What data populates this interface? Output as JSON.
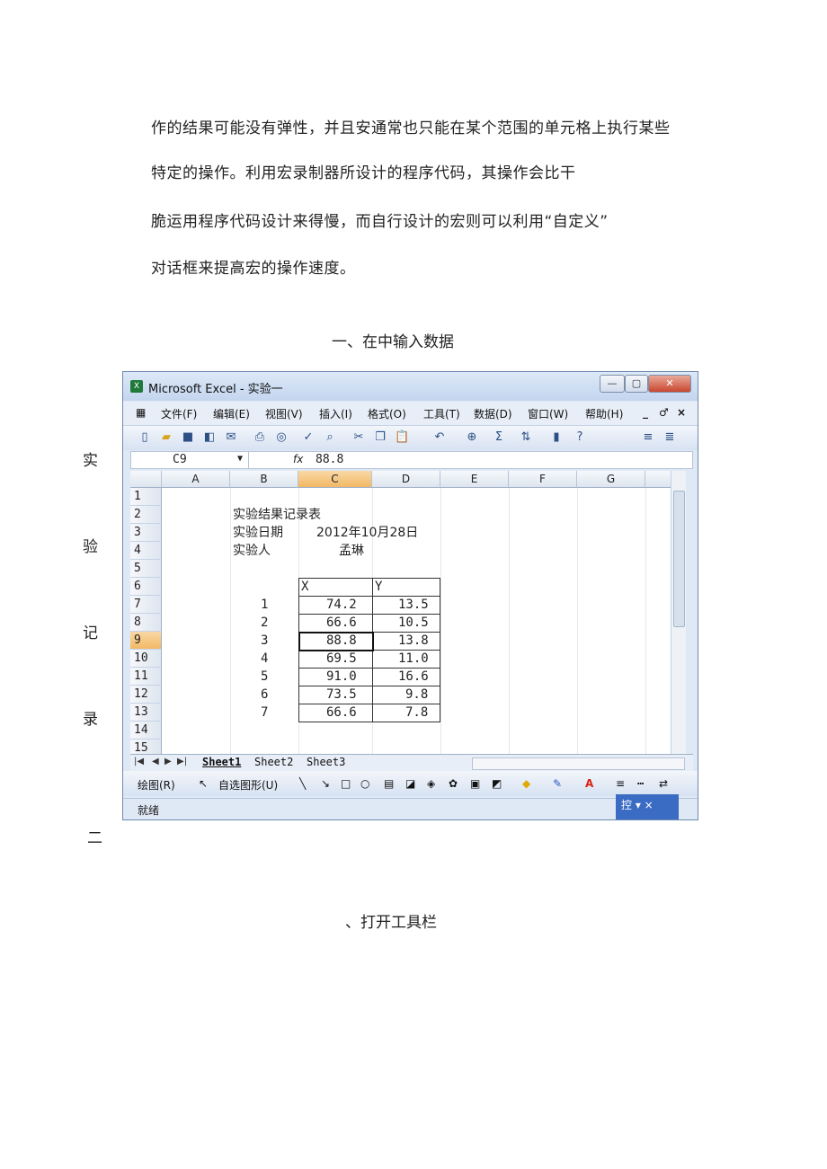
{
  "paragraph": [
    "作的结果可能没有弹性，并且安通常也只能在某个范围的单元格上执行某些",
    "特定的操作。利用宏录制器所设计的程序代码，其操作会比干",
    "脆运用程序代码设计来得慢，而自行设计的宏则可以利用“自定义”",
    "对话框来提高宏的操作速度。"
  ],
  "heading1": "一、在中输入数据",
  "side_chars": [
    "实",
    "验",
    "记",
    "录",
    "二"
  ],
  "heading2": "、打开工具栏",
  "excel": {
    "title": "Microsoft Excel - 实验一",
    "window_buttons": [
      "—",
      "▢",
      "✕"
    ],
    "menu": [
      "文件(F)",
      "编辑(E)",
      "视图(V)",
      "插入(I)",
      "格式(O)",
      "工具(T)",
      "数据(D)",
      "窗口(W)",
      "帮助(H)"
    ],
    "menu_right": [
      "_",
      "♂",
      "×"
    ],
    "name_box": "C9",
    "fx": "fx",
    "formula_value": "88.8",
    "columns": [
      "A",
      "B",
      "C",
      "D",
      "E",
      "F",
      "G"
    ],
    "rows": [
      "1",
      "2",
      "3",
      "4",
      "5",
      "6",
      "7",
      "8",
      "9",
      "10",
      "11",
      "12",
      "13",
      "14",
      "15"
    ],
    "title_cell": "实验结果记录表",
    "date_label": "实验日期",
    "date_value": "2012年10月28日",
    "person_label": "实验人",
    "person_value": "孟琳",
    "header_x": "X",
    "header_y": "Y",
    "data": [
      {
        "n": "1",
        "x": "74.2",
        "y": "13.5"
      },
      {
        "n": "2",
        "x": "66.6",
        "y": "10.5"
      },
      {
        "n": "3",
        "x": "88.8",
        "y": "13.8"
      },
      {
        "n": "4",
        "x": "69.5",
        "y": "11.0"
      },
      {
        "n": "5",
        "x": "91.0",
        "y": "16.6"
      },
      {
        "n": "6",
        "x": "73.5",
        "y": "9.8"
      },
      {
        "n": "7",
        "x": "66.6",
        "y": "7.8"
      }
    ],
    "sheets": [
      "Sheet1",
      "Sheet2",
      "Sheet3"
    ],
    "draw_label": "绘图(R)",
    "autoshape_label": "自选图形(U)",
    "status": "就绪",
    "control_box": "控 ▾ ×"
  }
}
